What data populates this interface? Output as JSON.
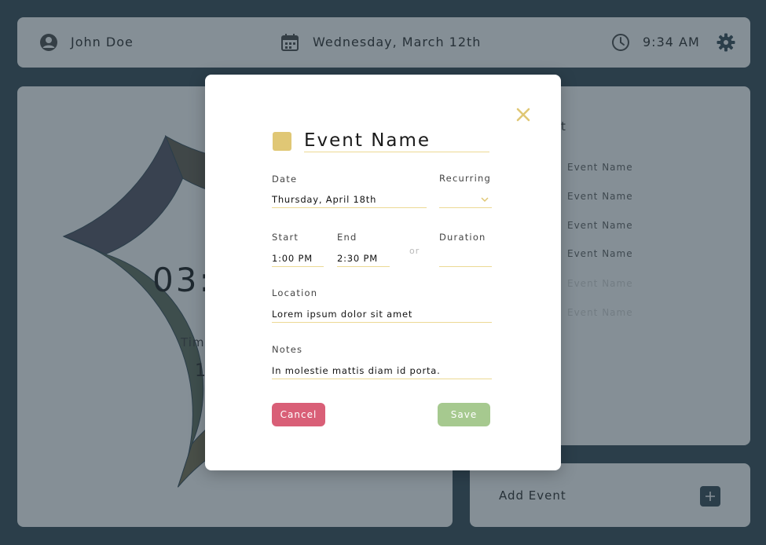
{
  "header": {
    "user_name": "John Doe",
    "date": "Wednesday, March 12th",
    "time": "9:34 AM"
  },
  "timer": {
    "time_display": "03:",
    "label": "Tim",
    "value": "1",
    "ring_colors": [
      "#5a5246",
      "#4b4858",
      "#556350",
      "#6d6446"
    ]
  },
  "event_list": {
    "title": "ist",
    "items": [
      {
        "label": "Event Name"
      },
      {
        "label": "Event Name"
      },
      {
        "label": "Event Name"
      },
      {
        "label": "Event Name"
      },
      {
        "label": "Event Name"
      },
      {
        "label": "Event Name"
      }
    ]
  },
  "add_event": {
    "label": "Add Event"
  },
  "modal": {
    "event_name": "Event Name",
    "swatch_color": "#e0c775",
    "date_label": "Date",
    "date_value": "Thursday, April 18th",
    "recurring_label": "Recurring",
    "recurring_value": "",
    "start_label": "Start",
    "start_value": "1:00 PM",
    "end_label": "End",
    "end_value": "2:30 PM",
    "or_text": "or",
    "duration_label": "Duration",
    "duration_value": "",
    "location_label": "Location",
    "location_value": "Lorem ipsum dolor sit amet",
    "notes_label": "Notes",
    "notes_value": "In molestie mattis diam id porta.",
    "cancel_label": "Cancel",
    "save_label": "Save"
  },
  "colors": {
    "background": "#2b3e4a",
    "panel": "#f2f2f2",
    "accent": "#e0c775",
    "cancel": "#d95f77",
    "save": "#a6c98f"
  }
}
